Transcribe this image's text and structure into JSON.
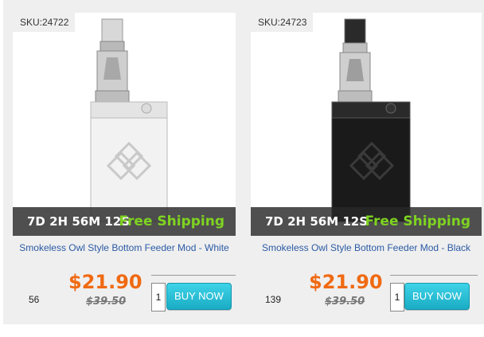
{
  "products": [
    {
      "sku": "SKU:24722",
      "countdown": "7D 2H 56M 12S",
      "shipping": "Free Shipping",
      "title": "Smokeless Owl Style Bottom Feeder Mod - White",
      "sales": "56",
      "price": "$21.90",
      "old_price": "$39.50",
      "quantity": "1",
      "buy_label": "BUY NOW",
      "body_color": "#f2f2f2"
    },
    {
      "sku": "SKU:24723",
      "countdown": "7D 2H 56M 12S",
      "shipping": "Free Shipping",
      "title": "Smokeless Owl Style Bottom Feeder Mod - Black",
      "sales": "139",
      "price": "$21.90",
      "old_price": "$39.50",
      "quantity": "1",
      "buy_label": "BUY NOW",
      "body_color": "#1a1a1a"
    }
  ],
  "colors": {
    "price": "#f06a12",
    "shipping": "#7ed321",
    "title_link": "#2b5aa5",
    "button": "#19acc4"
  }
}
